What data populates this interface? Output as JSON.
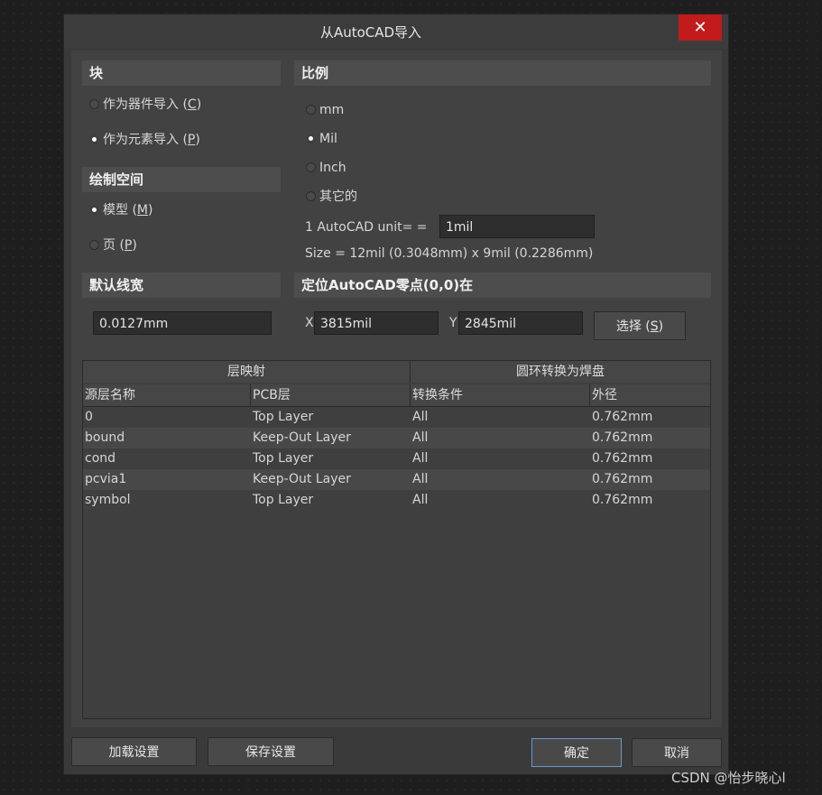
{
  "dialog": {
    "title": "从AutoCAD导入",
    "close_label": "✕"
  },
  "block": {
    "header": "块",
    "options": [
      {
        "label": "作为器件导入 (",
        "key": "C",
        "tail": ")",
        "selected": false
      },
      {
        "label": "作为元素导入 (",
        "key": "P",
        "tail": ")",
        "selected": true
      }
    ]
  },
  "space": {
    "header": "绘制空间",
    "options": [
      {
        "label": "模型 (",
        "key": "M",
        "tail": ")",
        "selected": true
      },
      {
        "label": "页 (",
        "key": "P",
        "tail": ")",
        "selected": false
      }
    ]
  },
  "scale": {
    "header": "比例",
    "options": [
      {
        "label": "mm",
        "selected": false
      },
      {
        "label": "Mil",
        "selected": true
      },
      {
        "label": "Inch",
        "selected": false
      },
      {
        "label": "其它的",
        "selected": false
      }
    ],
    "unit_label": "1 AutoCAD unit= =",
    "unit_value": "1mil",
    "size_text": "Size = 12mil (0.3048mm) x 9mil (0.2286mm)"
  },
  "linewidth": {
    "header": "默认线宽",
    "value": "0.0127mm"
  },
  "origin": {
    "header": "定位AutoCAD零点(0,0)在",
    "x_label": "X",
    "x_value": "3815mil",
    "y_label": "Y",
    "y_value": "2845mil",
    "select_label": "选择 (",
    "select_key": "S",
    "select_tail": ")"
  },
  "table": {
    "group_headers": [
      "层映射",
      "圆环转换为焊盘"
    ],
    "columns": [
      "源层名称",
      "PCB层",
      "转换条件",
      "外径"
    ],
    "rows": [
      [
        "0",
        "Top Layer",
        "All",
        "0.762mm"
      ],
      [
        "bound",
        "Keep-Out Layer",
        "All",
        "0.762mm"
      ],
      [
        "cond",
        "Top Layer",
        "All",
        "0.762mm"
      ],
      [
        "pcvia1",
        "Keep-Out Layer",
        "All",
        "0.762mm"
      ],
      [
        "symbol",
        "Top Layer",
        "All",
        "0.762mm"
      ]
    ]
  },
  "footer": {
    "load_label": "加载设置",
    "save_label": "保存设置",
    "ok_label": "确定",
    "cancel_label": "取消"
  },
  "watermark": "CSDN @怡步晓心l"
}
